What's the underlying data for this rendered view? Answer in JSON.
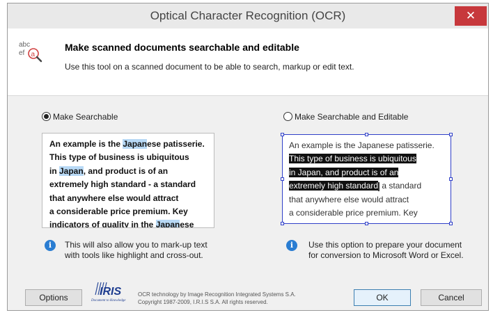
{
  "window": {
    "title": "Optical Character Recognition (OCR)",
    "close_glyph": "✕"
  },
  "header": {
    "icon": "abc-ef-magnifier-icon",
    "icon_text_top": "abc",
    "icon_text_bottom": "ef",
    "icon_letter": "a",
    "title": "Make scanned documents searchable and editable",
    "subtitle": "Use this tool on a scanned document to be able to search, markup or edit text."
  },
  "options": [
    {
      "label": "Make Searchable",
      "selected": true,
      "preview": [
        [
          {
            "t": "An example is the "
          },
          {
            "t": "Japan",
            "hl": true
          },
          {
            "t": "ese patisserie."
          }
        ],
        [
          {
            "t": "This type of business is ubiquitous"
          }
        ],
        [
          {
            "t": "in "
          },
          {
            "t": "Japan",
            "hl": true
          },
          {
            "t": ", and product is of an"
          }
        ],
        [
          {
            "t": "extremely high standard - a standard"
          }
        ],
        [
          {
            "t": "that anywhere else would attract"
          }
        ],
        [
          {
            "t": "a considerable price premium. Key"
          }
        ],
        [
          {
            "t": "indicators of quality in the "
          },
          {
            "t": "Japan",
            "hl": true
          },
          {
            "t": "ese"
          }
        ]
      ],
      "info": [
        "This will also allow you to mark-up text",
        "with tools like highlight and cross-out."
      ]
    },
    {
      "label": "Make Searchable and Editable",
      "selected": false,
      "preview": [
        [
          {
            "t": "An example is the Japanese patisserie."
          }
        ],
        [
          {
            "t": "This type of business is ubiquitous",
            "sel": true
          }
        ],
        [
          {
            "t": "in Japan, and product is of an",
            "sel": true
          }
        ],
        [
          {
            "t": "extremely high standard",
            "sel": true
          },
          {
            "cursor": true
          },
          {
            "t": " a standard"
          }
        ],
        [
          {
            "t": "that anywhere else would attract"
          }
        ],
        [
          {
            "t": "a considerable price premium. Key"
          }
        ]
      ],
      "info": [
        "Use this option to prepare your document",
        "for conversion to Microsoft Word or Excel."
      ]
    }
  ],
  "footer": {
    "options_label": "Options",
    "logo_text": "IRIS",
    "logo_tagline": "Document to Knowledge",
    "copyright_lines": [
      "OCR technology by Image Recognition Integrated Systems S.A.",
      "Copyright 1987-2009, I.R.I.S S.A. All rights reserved."
    ],
    "ok_label": "OK",
    "cancel_label": "Cancel"
  },
  "colors": {
    "close": "#c7383c",
    "info": "#2a7dd2",
    "highlight": "#b8d9f5",
    "selection_frame": "#2f3fc8"
  }
}
